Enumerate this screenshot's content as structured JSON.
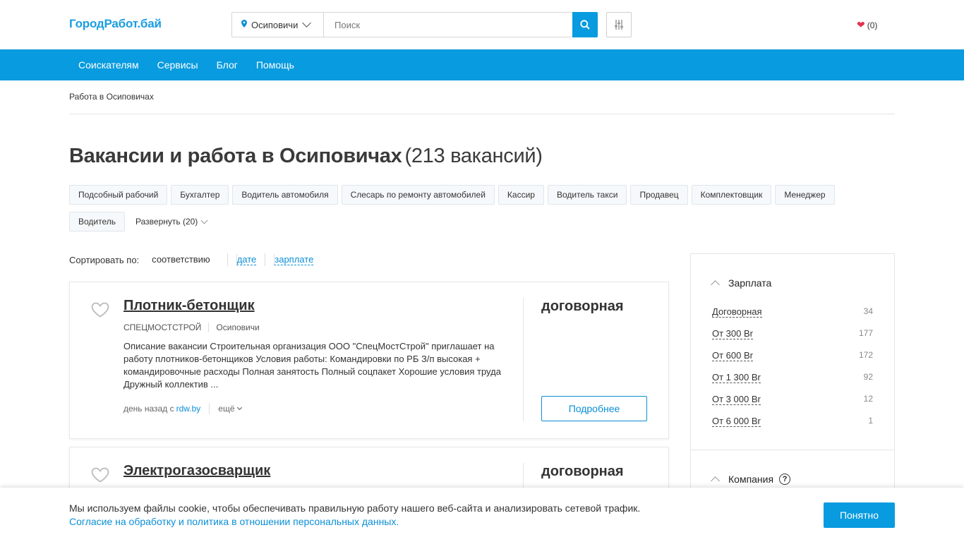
{
  "header": {
    "logo": "ГородРабот.бай",
    "city": "Осиповичи",
    "search_placeholder": "Поиск",
    "favorites_count": "(0)"
  },
  "nav": {
    "items": [
      "Соискателям",
      "Сервисы",
      "Блог",
      "Помощь"
    ]
  },
  "breadcrumb": "Работа в Осиповичах",
  "page": {
    "title": "Вакансии и работа в Осиповичах",
    "count": "(213 вакансий)"
  },
  "tags": [
    "Подсобный рабочий",
    "Бухгалтер",
    "Водитель автомобиля",
    "Слесарь по ремонту автомобилей",
    "Кассир",
    "Водитель такси",
    "Продавец",
    "Комплектовщик",
    "Менеджер",
    "Водитель"
  ],
  "tags_expand": "Развернуть (20)",
  "sort": {
    "label": "Сортировать по:",
    "active": "соответствию",
    "option_date": "дате",
    "option_salary": "зарплате"
  },
  "vacancies": [
    {
      "title": "Плотник-бетонщик",
      "company": "СПЕЦМОСТСТРОЙ",
      "city": "Осиповичи",
      "description": "Описание вакансии Строительная организация ООО \"СпецМостСтрой\" приглашает на работу плотников-бетонщиков Условия работы: Командировки по РБ З/п высокая + командировочные расходы Полная занятость Полный соцпакет Хорошие условия труда Дружный коллектив ...",
      "posted": "день назад с",
      "source": "rdw.by",
      "more": "ещё",
      "salary": "договорная",
      "details_button": "Подробнее"
    },
    {
      "title": "Электрогазосварщик",
      "salary": "договорная"
    }
  ],
  "sidebar": {
    "salary_heading": "Зарплата",
    "salary_filters": [
      {
        "label": "Договорная",
        "count": "34"
      },
      {
        "label": "От 300 Br",
        "count": "177"
      },
      {
        "label": "От 600 Br",
        "count": "172"
      },
      {
        "label": "От 1 300 Br",
        "count": "92"
      },
      {
        "label": "От 3 000 Br",
        "count": "12"
      },
      {
        "label": "От 6 000 Br",
        "count": "1"
      }
    ],
    "company_heading": "Компания",
    "help_symbol": "?"
  },
  "cookie": {
    "text": "Мы используем файлы cookie, чтобы обеспечивать правильную работу нашего веб-сайта и анализировать сетевой трафик.",
    "link": "Согласие на обработку и политика в отношении персональных данных.",
    "button": "Понятно"
  },
  "colors": {
    "brand_blue": "#089bdf",
    "link_blue": "#0b8fd6",
    "heart_red": "#e0344a"
  }
}
